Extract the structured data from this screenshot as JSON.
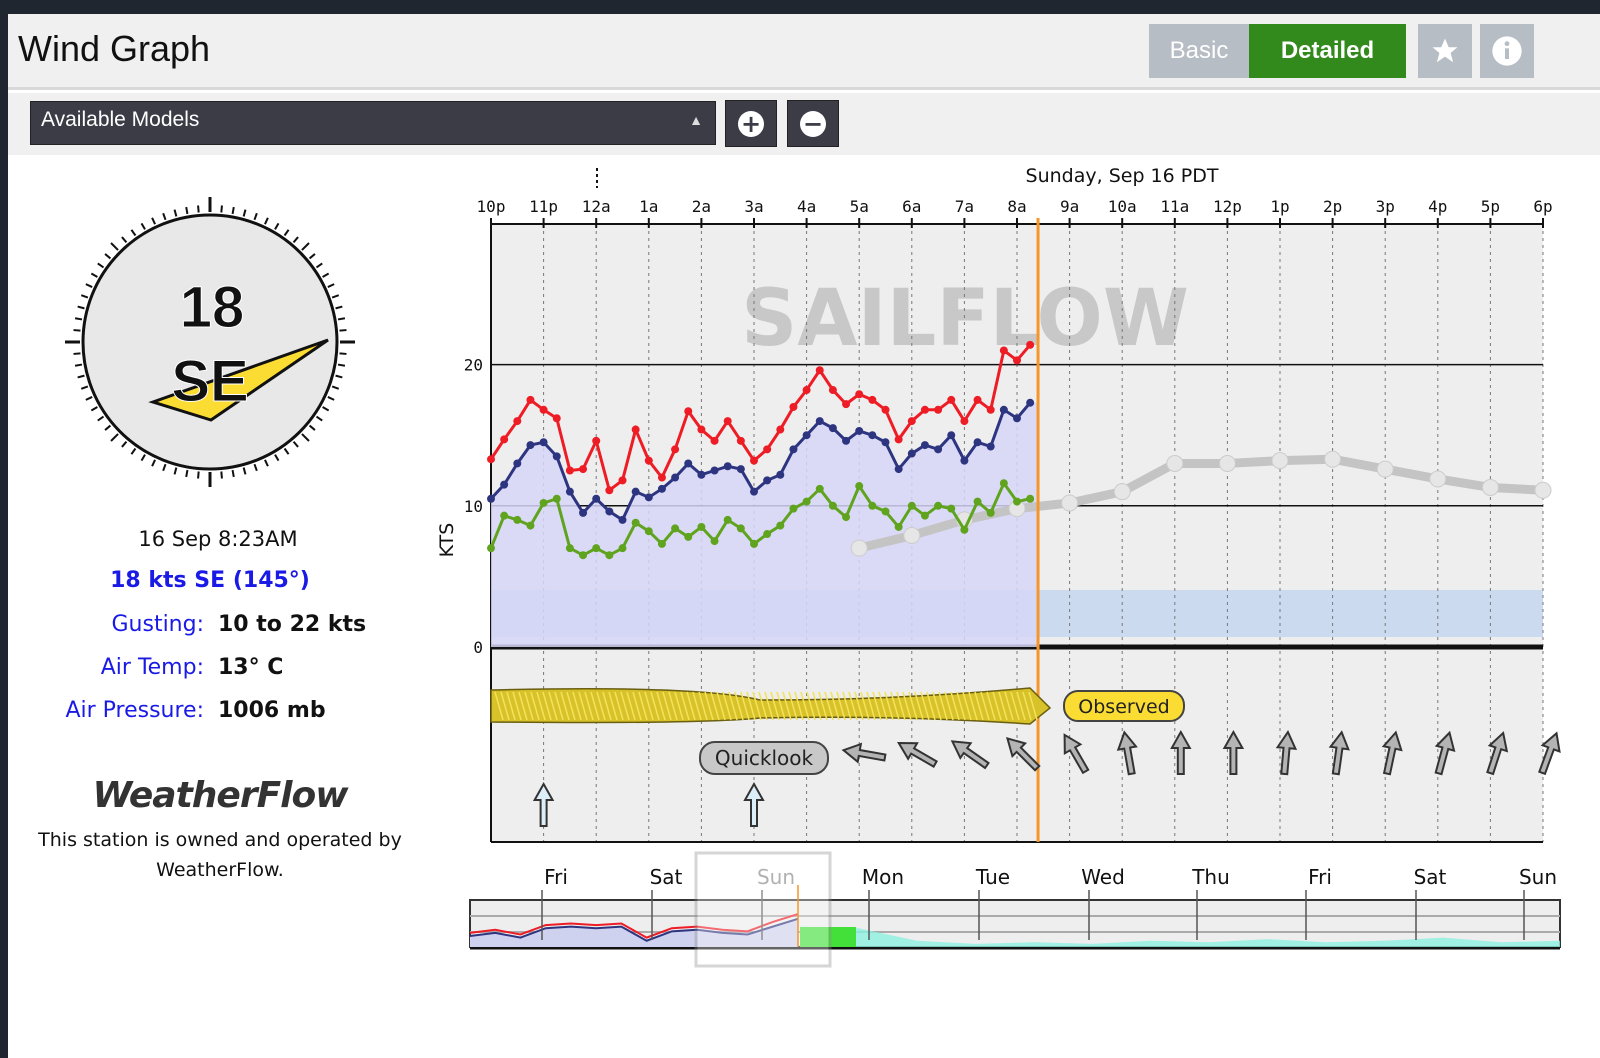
{
  "header": {
    "title": "Wind Graph",
    "basic_label": "Basic",
    "detailed_label": "Detailed",
    "star_icon": "star-icon",
    "info_icon": "info-icon"
  },
  "toolbar": {
    "models_select": "Available Models",
    "zoom_in_icon": "plus-circle-icon",
    "zoom_out_icon": "minus-circle-icon"
  },
  "compass": {
    "speed": "18",
    "direction": "SE",
    "degrees": 145
  },
  "station": {
    "timestamp": "16 Sep 8:23AM",
    "speed_line": "18 kts SE (145°)",
    "gusting_label": "Gusting:",
    "gusting_value": "10 to 22 kts",
    "temp_label": "Air Temp:",
    "temp_value": "13° C",
    "pressure_label": "Air Pressure:",
    "pressure_value": "1006 mb",
    "logo": "WeatherFlow",
    "ownership": "This station is owned and operated by WeatherFlow."
  },
  "chart_data": {
    "type": "line",
    "date_label": "Sunday, Sep 16 PDT",
    "ylabel": "KTS",
    "ylim": [
      0,
      30
    ],
    "yticks": [
      0,
      10,
      20
    ],
    "watermark": "SAILFLOW",
    "xticks": [
      "10p",
      "11p",
      "12a",
      "1a",
      "2a",
      "3a",
      "4a",
      "5a",
      "6a",
      "7a",
      "8a",
      "9a",
      "10a",
      "11a",
      "12p",
      "1p",
      "2p",
      "3p",
      "4p",
      "5p",
      "6p"
    ],
    "now_hour_offset": 10.4,
    "observed_interval_hours": 0.25,
    "series": [
      {
        "name": "gust",
        "color": "#ee1c25",
        "values": [
          13.3,
          14.7,
          16,
          17.5,
          16.8,
          16.2,
          12.5,
          12.6,
          14.6,
          11.1,
          11.8,
          15.4,
          13.2,
          12,
          14,
          16.7,
          15.4,
          14.6,
          16,
          14.6,
          13.2,
          14,
          15.4,
          17,
          18.2,
          19.6,
          18.2,
          17.2,
          17.9,
          17.5,
          16.8,
          14.7,
          16,
          16.8,
          16.8,
          17.5,
          16,
          17.5,
          16.8,
          21,
          20.3,
          21.4
        ]
      },
      {
        "name": "average",
        "color": "#2e3580",
        "values": [
          10.5,
          11.5,
          13,
          14.3,
          14.5,
          13.5,
          11,
          9.5,
          10.5,
          9.6,
          9,
          11,
          10.6,
          11.2,
          12,
          13,
          12.2,
          12.5,
          12.8,
          12.6,
          11,
          11.8,
          12.2,
          14,
          15,
          16,
          15.5,
          14.6,
          15.3,
          15,
          14.5,
          12.6,
          13.7,
          14.3,
          14,
          15,
          13.2,
          14.5,
          14.2,
          16.8,
          16.2,
          17.3
        ]
      },
      {
        "name": "lull",
        "color": "#5fa31e",
        "values": [
          7,
          9.3,
          9,
          8.6,
          10.2,
          10.5,
          7,
          6.5,
          7,
          6.5,
          7,
          8.8,
          8.2,
          7.3,
          8.4,
          7.8,
          8.5,
          7.5,
          9,
          8.4,
          7.3,
          8,
          8.6,
          9.8,
          10.3,
          11.2,
          10,
          9.2,
          11.4,
          10,
          9.6,
          8.5,
          10,
          9.3,
          10,
          9.8,
          8.3,
          10.3,
          9.5,
          11.6,
          10.3,
          10.5
        ]
      }
    ],
    "forecast": {
      "color": "#c4c4c4",
      "hours": [
        "5a",
        "6a",
        "7a",
        "8a",
        "9a",
        "10a",
        "11a",
        "12p",
        "1p",
        "2p",
        "3p",
        "4p",
        "5p",
        "6p"
      ],
      "values": [
        7.0,
        7.9,
        9.0,
        9.8,
        10.2,
        11,
        13,
        13,
        13.2,
        13.3,
        12.6,
        11.9,
        11.3,
        11.1
      ]
    },
    "forecast_arrows_deg": [
      -80,
      -60,
      -55,
      -45,
      -30,
      -10,
      0,
      0,
      5,
      8,
      12,
      15,
      18,
      20
    ],
    "quicklook_arrows": {
      "hours": [
        "11p",
        "3a"
      ],
      "deg": [
        0,
        0
      ]
    },
    "observed_badge": "Observed",
    "quicklook_badge": "Quicklook",
    "accent": {
      "now_line": "#f5962a",
      "fill": "#d6d6f7",
      "band": "#b5cdf2"
    }
  },
  "overview": {
    "days": [
      "Fri",
      "Sat",
      "Sun",
      "Mon",
      "Tue",
      "Wed",
      "Thu",
      "Fri",
      "Sat",
      "Sun"
    ],
    "selected_day": "Sun",
    "ylim": [
      0,
      30
    ],
    "gust": [
      9,
      11,
      8,
      14,
      15,
      14,
      15,
      6,
      12,
      13,
      11,
      10,
      16,
      21
    ],
    "average": [
      7,
      9,
      6,
      12,
      13,
      12,
      13,
      4,
      10,
      11,
      9,
      8,
      13,
      18
    ],
    "forecast": [
      13,
      12,
      4,
      2,
      3,
      2,
      4,
      3,
      5,
      3,
      4,
      6,
      3,
      4
    ]
  }
}
